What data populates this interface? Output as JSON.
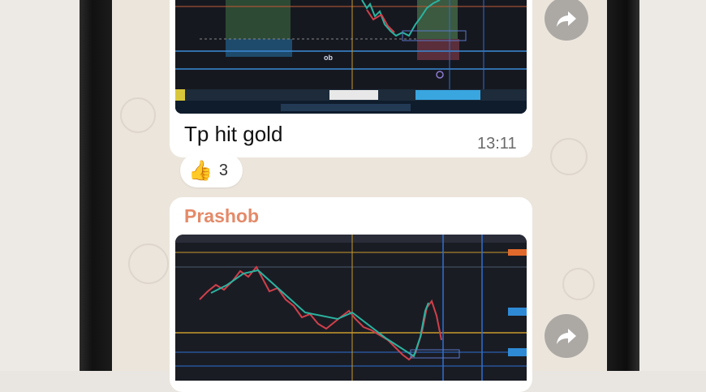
{
  "messages": [
    {
      "caption": "Tp hit gold",
      "time": "13:11",
      "reaction": {
        "emoji": "👍",
        "count": "3"
      },
      "chart_labels": {
        "ob": "ob"
      }
    },
    {
      "sender": "Prashob"
    }
  ],
  "colors": {
    "sender": "#e48a69",
    "bubble": "#ffffff",
    "chat_background": "#ece5dc"
  },
  "icons": [
    "forward-icon",
    "thumbs-up-icon"
  ]
}
